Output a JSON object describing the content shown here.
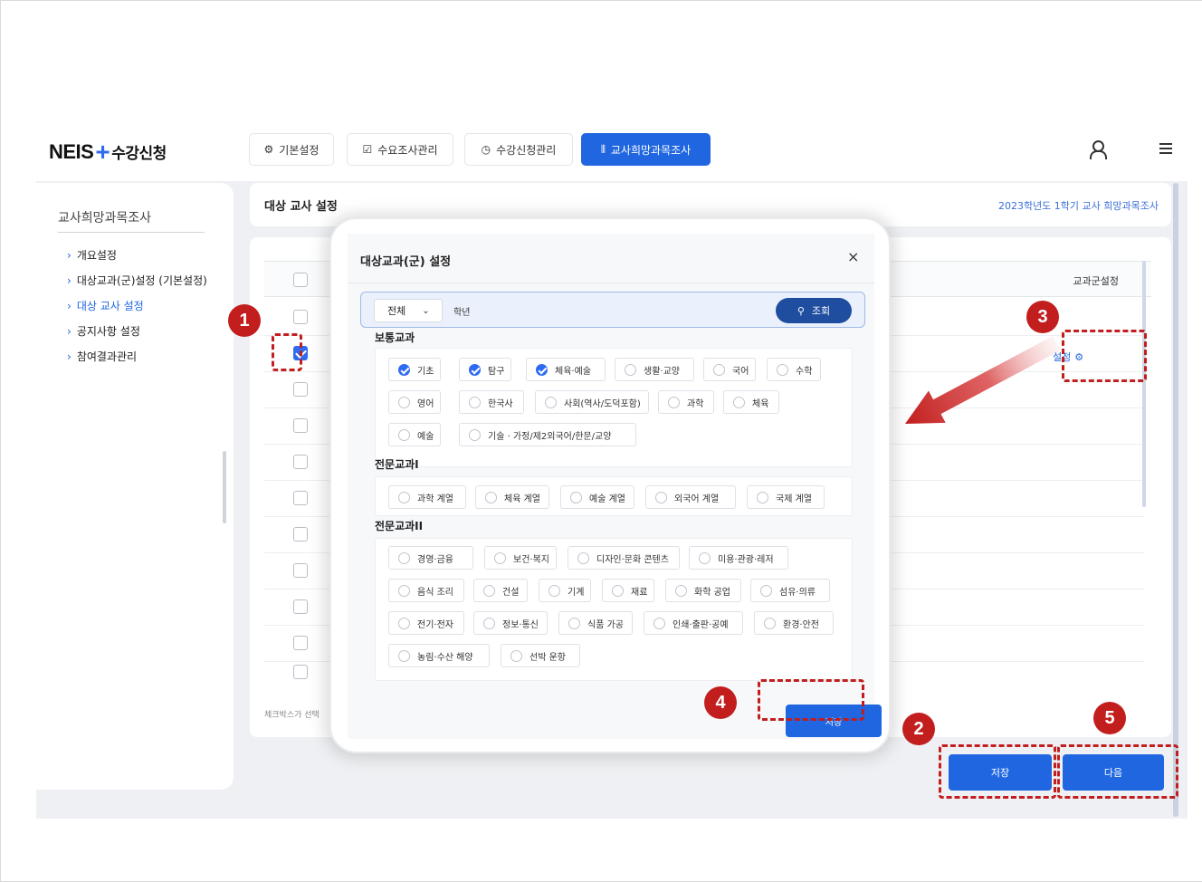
{
  "app": {
    "logo_main": "NEIS",
    "logo_plus": "+",
    "logo_sub": "수강신청"
  },
  "tabs": [
    {
      "label": "기본설정",
      "icon": "gear-icon"
    },
    {
      "label": "수요조사관리",
      "icon": "check-circle-icon"
    },
    {
      "label": "수강신청관리",
      "icon": "clock-icon"
    },
    {
      "label": "교사희망과목조사",
      "icon": "chart-icon",
      "active": true
    }
  ],
  "sidebar": {
    "title": "교사희망과목조사",
    "items": [
      {
        "label": "개요설정"
      },
      {
        "label": "대상교과(군)설정 (기본설정)"
      },
      {
        "label": "대상 교사 설정",
        "active": true
      },
      {
        "label": "공지사항 설정"
      },
      {
        "label": "참여결과관리"
      }
    ]
  },
  "panel": {
    "title": "대상 교사 설정",
    "term": "2023학년도 1학기 교사 희망과목조사",
    "column_header": "교과군설정",
    "set_link": "설정",
    "note": "체크박스가 선택"
  },
  "buttons": {
    "save": "저장",
    "next": "다음"
  },
  "modal": {
    "title": "대상교과(군) 설정",
    "close": "×",
    "select_value": "전체",
    "grade_label": "학년",
    "search_label": "조회",
    "save": "저장",
    "sections": [
      {
        "label": "보통교과",
        "items": [
          {
            "label": "기초",
            "checked": true
          },
          {
            "label": "탐구",
            "checked": true
          },
          {
            "label": "체육·예술",
            "checked": true
          },
          {
            "label": "생활·교양",
            "checked": false
          },
          {
            "label": "국어",
            "checked": false
          },
          {
            "label": "수학",
            "checked": false
          },
          {
            "label": "영어",
            "checked": false
          },
          {
            "label": "한국사",
            "checked": false
          },
          {
            "label": "사회(역사/도덕포함)",
            "checked": false
          },
          {
            "label": "과학",
            "checked": false
          },
          {
            "label": "체육",
            "checked": false
          },
          {
            "label": "예술",
            "checked": false
          },
          {
            "label": "기술 · 가정/제2외국어/한문/교양",
            "checked": false
          }
        ]
      },
      {
        "label": "전문교과I",
        "items": [
          {
            "label": "과학 계열",
            "checked": false
          },
          {
            "label": "체육 계열",
            "checked": false
          },
          {
            "label": "예술 계열",
            "checked": false
          },
          {
            "label": "외국어 계열",
            "checked": false
          },
          {
            "label": "국제 계열",
            "checked": false
          }
        ]
      },
      {
        "label": "전문교과II",
        "items": [
          {
            "label": "경영·금융",
            "checked": false
          },
          {
            "label": "보건·복지",
            "checked": false
          },
          {
            "label": "디자인·문화 콘텐츠",
            "checked": false
          },
          {
            "label": "미용·관광·레저",
            "checked": false
          },
          {
            "label": "음식 조리",
            "checked": false
          },
          {
            "label": "건설",
            "checked": false
          },
          {
            "label": "기계",
            "checked": false
          },
          {
            "label": "재료",
            "checked": false
          },
          {
            "label": "화학 공업",
            "checked": false
          },
          {
            "label": "섬유·의류",
            "checked": false
          },
          {
            "label": "전기·전자",
            "checked": false
          },
          {
            "label": "정보·통신",
            "checked": false
          },
          {
            "label": "식품 가공",
            "checked": false
          },
          {
            "label": "인쇄·출판·공예",
            "checked": false
          },
          {
            "label": "환경·안전",
            "checked": false
          },
          {
            "label": "농림·수산 해양",
            "checked": false
          },
          {
            "label": "선박 운항",
            "checked": false
          }
        ]
      }
    ]
  },
  "callouts": [
    "1",
    "2",
    "3",
    "4",
    "5"
  ],
  "colors": {
    "accent": "#1f66e0",
    "callout": "#c21e1e"
  }
}
